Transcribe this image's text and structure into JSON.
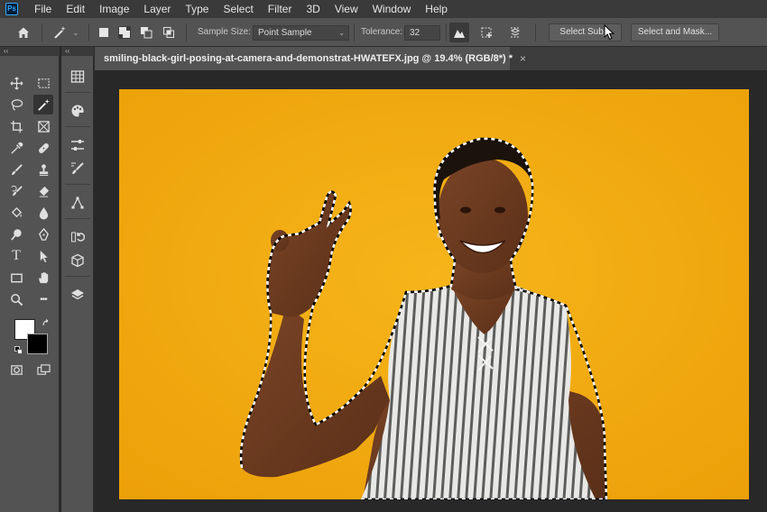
{
  "app": {
    "logo_text": "Ps"
  },
  "menu": [
    "File",
    "Edit",
    "Image",
    "Layer",
    "Type",
    "Select",
    "Filter",
    "3D",
    "View",
    "Window",
    "Help"
  ],
  "options_bar": {
    "sample_size_label": "Sample Size:",
    "sample_size_value": "Point Sample",
    "tolerance_label": "Tolerance:",
    "tolerance_value": "32",
    "select_subject_label": "Select Subje",
    "select_and_mask_label": "Select and Mask..."
  },
  "toolbar": {
    "collapse_glyph": "‹‹",
    "tools": [
      "move-icon",
      "rectangular-marquee-icon",
      "lasso-icon",
      "magic-wand-icon",
      "crop-icon",
      "frame-icon",
      "eyedropper-icon",
      "spot-healing-icon",
      "brush-icon",
      "clone-stamp-icon",
      "history-brush-icon",
      "eraser-icon",
      "paint-bucket-icon",
      "blur-icon",
      "dodge-icon",
      "pen-icon",
      "type-icon",
      "path-selection-icon",
      "rectangle-icon",
      "hand-icon",
      "zoom-icon",
      "more-tools-icon"
    ],
    "active_tool": "magic-wand-icon",
    "type_tool_glyph": "T",
    "more_tools_glyph": "•••",
    "foreground_color": "#ffffff",
    "background_color": "#000000"
  },
  "panels": {
    "collapse_glyph": "‹‹",
    "icons": [
      "table-icon",
      "palette-icon",
      "adjust-icon",
      "brushes-icon",
      "paths-icon",
      "history-icon",
      "3d-icon",
      "layers-icon"
    ]
  },
  "document": {
    "tab_title": "smiling-black-girl-posing-at-camera-and-demonstrat-HWATEFX.jpg @ 19.4% (RGB/8*) *",
    "close_glyph": "×"
  },
  "colors": {
    "backdrop": "#f2ad10",
    "skin": "#6b3a20",
    "hair": "#1c120c",
    "top_stripe_light": "#e8e8e6",
    "top_stripe_dark": "#5d5d5b",
    "selection_marquee": "#ffffff"
  }
}
